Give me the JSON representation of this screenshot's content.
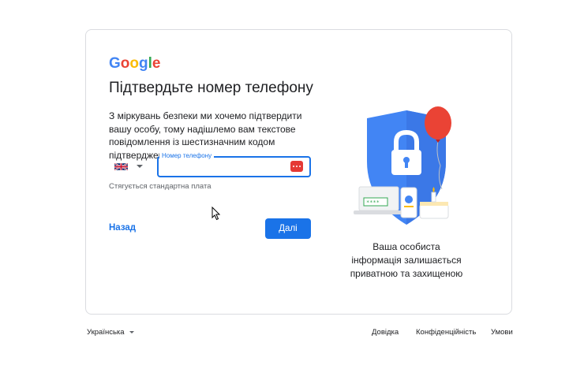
{
  "logo": {
    "text": "Google"
  },
  "title": "Підтвердьте номер телефону",
  "description": "З міркувань безпеки ми хочемо підтвердити вашу особу, тому надішлемо вам текстове повідомлення із шестизначним кодом підтвердження.",
  "phone": {
    "label": "Номер телефону",
    "value": "",
    "country_flag": "uk-flag-icon"
  },
  "fee_note": "Стягується стандартна плата",
  "buttons": {
    "back": "Назад",
    "next": "Далі"
  },
  "caption": "Ваша особиста інформація залишається приватною та захищеною",
  "footer": {
    "language": "Українська",
    "help": "Довідка",
    "privacy": "Конфіденційність",
    "terms": "Умови"
  },
  "colors": {
    "accent": "#1a73e8",
    "shield": "#4285f4",
    "balloon": "#ea4335"
  }
}
